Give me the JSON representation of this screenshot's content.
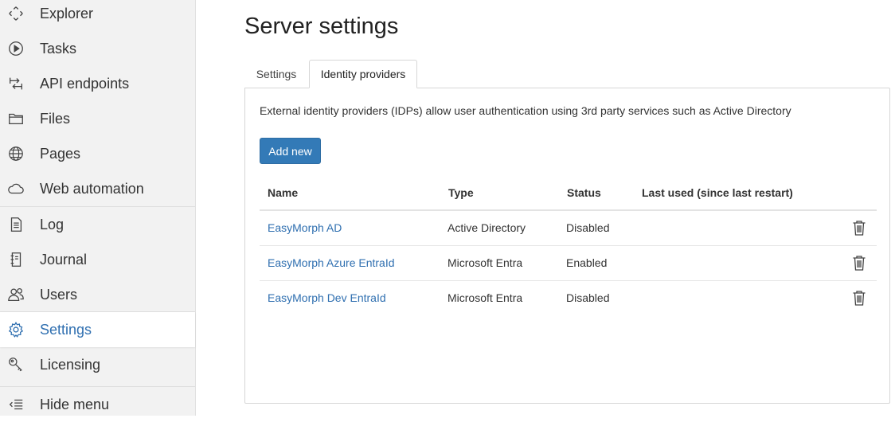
{
  "sidebar": {
    "items": [
      {
        "label": "Explorer",
        "icon": "move-arrows-icon"
      },
      {
        "label": "Tasks",
        "icon": "play-circle-icon"
      },
      {
        "label": "API endpoints",
        "icon": "swap-arrows-icon"
      },
      {
        "label": "Files",
        "icon": "folder-icon"
      },
      {
        "label": "Pages",
        "icon": "globe-icon"
      },
      {
        "label": "Web automation",
        "icon": "cloud-icon"
      },
      {
        "label": "Log",
        "icon": "document-icon"
      },
      {
        "label": "Journal",
        "icon": "notebook-icon"
      },
      {
        "label": "Users",
        "icon": "users-icon"
      },
      {
        "label": "Settings",
        "icon": "gear-icon"
      },
      {
        "label": "Licensing",
        "icon": "key-icon"
      }
    ],
    "hide_menu": "Hide menu",
    "active": "Settings",
    "accent": "#2f6fb0"
  },
  "main": {
    "title": "Server settings",
    "tabs": [
      {
        "label": "Settings"
      },
      {
        "label": "Identity providers"
      }
    ],
    "active_tab": "Identity providers",
    "description": "External identity providers (IDPs) allow user authentication using 3rd party services such as Active Directory",
    "add_button": "Add new",
    "button_color": "#337ab7",
    "table": {
      "headers": [
        "Name",
        "Type",
        "Status",
        "Last used (since last restart)"
      ],
      "rows": [
        {
          "name": "EasyMorph AD",
          "type": "Active Directory",
          "status": "Disabled",
          "last_used": ""
        },
        {
          "name": "EasyMorph Azure EntraId",
          "type": "Microsoft Entra",
          "status": "Enabled",
          "last_used": ""
        },
        {
          "name": "EasyMorph Dev EntraId",
          "type": "Microsoft Entra",
          "status": "Disabled",
          "last_used": ""
        }
      ]
    }
  }
}
